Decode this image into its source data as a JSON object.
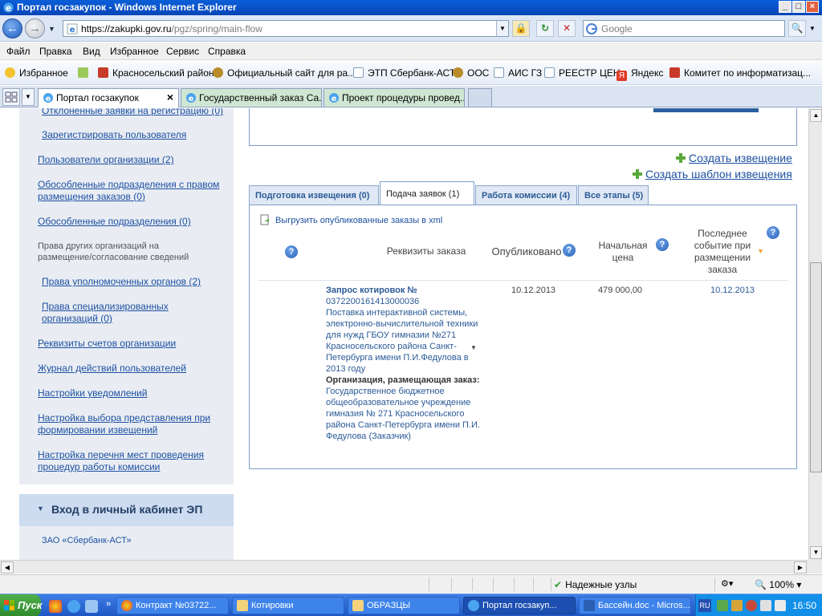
{
  "window": {
    "title": "Портал госзакупок - Windows Internet Explorer"
  },
  "address": {
    "url_main": "https://zakupki.gov.ru",
    "url_path": "/pgz/spring/main-flow",
    "search_placeholder": "Google"
  },
  "menu": [
    "Файл",
    "Правка",
    "Вид",
    "Избранное",
    "Сервис",
    "Справка"
  ],
  "favorites": {
    "label": "Избранное",
    "items": [
      "Красносельский район",
      "Официальный сайт для ра...",
      "ЭТП Сбербанк-АСТ",
      "ООС",
      "АИС ГЗ",
      "РЕЕСТР ЦЕН",
      "Яндекс",
      "Комитет по информатизац..."
    ]
  },
  "browser_tabs": [
    {
      "label": "Портал госзакупок",
      "active": true
    },
    {
      "label": "Государственный заказ Са...",
      "active": false
    },
    {
      "label": "Проект процедуры провед...",
      "active": false
    }
  ],
  "sidebar": {
    "links": [
      "Отклоненные заявки на регистрацию (0)",
      "Зарегистрировать пользователя",
      "Пользователи организации (2)",
      "Обособленные подразделения с правом размещения заказов (0)",
      "Обособленные подразделения (0)",
      "Права уполномоченных органов (2)",
      "Права специализированных организаций (0)",
      "Реквизиты счетов организации",
      "Журнал действий пользователей",
      "Настройки уведомлений",
      "Настройка выбора представления при формировании извещений",
      "Настройка перечня мест проведения процедур работы комиссии"
    ],
    "note": "Права других организаций на размещение/согласование сведений",
    "login_title": "Вход в личный кабинет ЭП",
    "login_org": "ЗАО «Сбербанк-АСТ»"
  },
  "actions": {
    "create_notice": "Создать извещение",
    "create_template": "Создать шаблон извещения"
  },
  "stage_tabs": [
    {
      "label": "Подготовка извещения (0)",
      "active": false
    },
    {
      "label": "Подача заявок (1)",
      "active": true
    },
    {
      "label": "Работа комиссии (4)",
      "active": false
    },
    {
      "label": "Все этапы (5)",
      "active": false
    }
  ],
  "table": {
    "export_link": "Выгрузить опубликованные заказы в xml",
    "headers": {
      "requisites": "Реквизиты заказа",
      "published": "Опубликовано",
      "price": "Начальная цена",
      "last_event": "Последнее событие при размещении заказа"
    },
    "rows": [
      {
        "order_type": "Запрос котировок  №",
        "order_number": "0372200161413000036",
        "description": "Поставка интерактивной системы, электронно-вычислительной техники для нужд ГБОУ гимназии №271 Красносельского района Санкт-Петербурга имени П.И.Федулова в 2013 году",
        "org_label": "Организация, размещающая заказ:",
        "org_name": "Государственное бюджетное общеобразовательное учреждение гимназия № 271 Красносельского района Санкт-Петербурга имени П.И. Федулова (Заказчик)",
        "published": "10.12.2013",
        "price": "479 000,00",
        "last_event": "10.12.2013"
      }
    ]
  },
  "statusbar": {
    "zone": "Надежные узлы",
    "zoom": "100%"
  },
  "taskbar": {
    "start": "Пуск",
    "tasks": [
      {
        "label": "Контракт №03722...",
        "active": false
      },
      {
        "label": "Котировки",
        "active": false
      },
      {
        "label": "ОБРАЗЦЫ",
        "active": false
      },
      {
        "label": "Портал госзакуп...",
        "active": true
      },
      {
        "label": "Бассейн.doc - Micros...",
        "active": false
      }
    ],
    "lang": "RU",
    "clock": "16:50"
  },
  "colors": {
    "link": "#1d50a2",
    "panel_border": "#7d9fc9",
    "sidebar_bg": "#e9edf3",
    "accent_orange": "#f2a33a"
  }
}
